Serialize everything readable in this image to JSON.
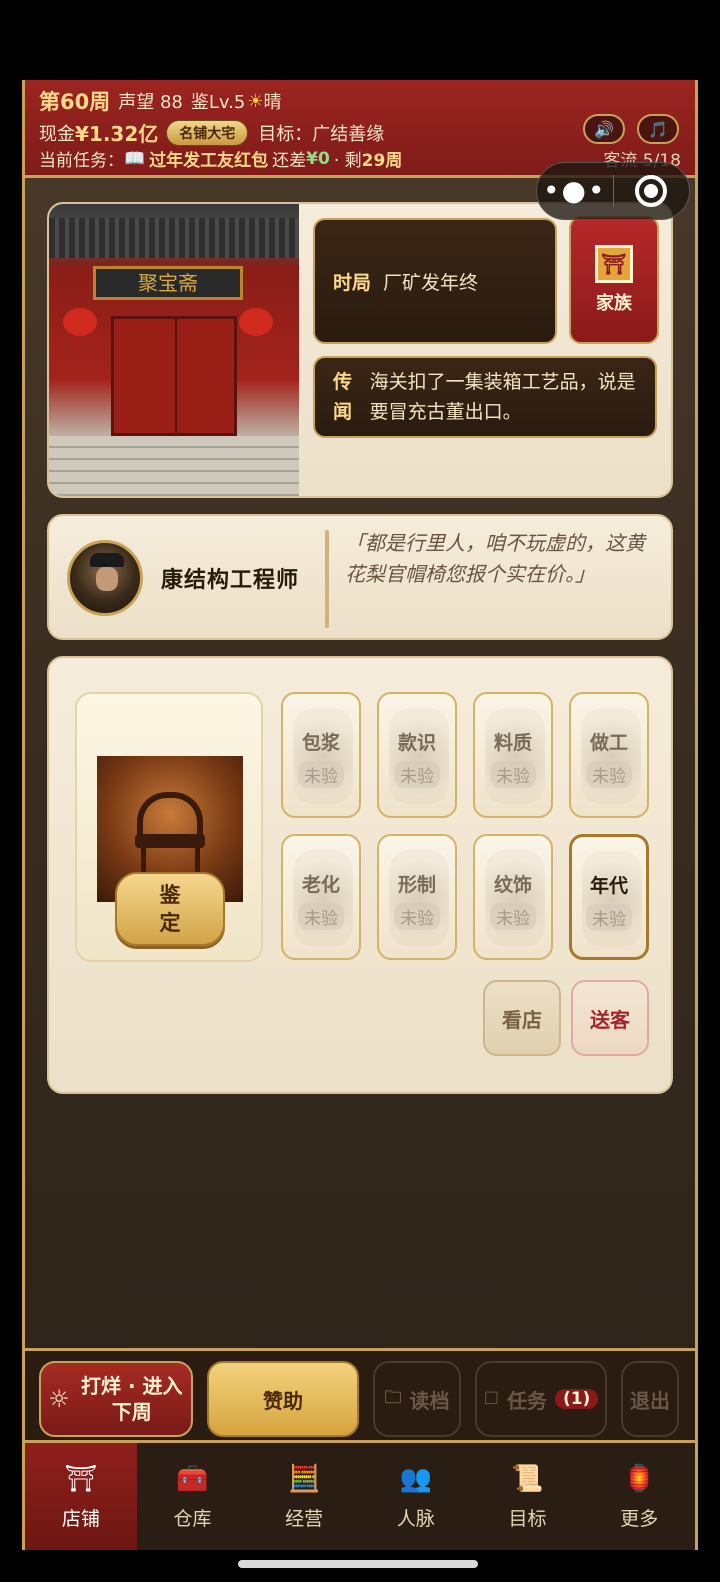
{
  "header": {
    "week": "第60周",
    "reputation": "声望 88",
    "level": "鉴Lv.5",
    "weather_icon": "☀",
    "weather": "晴",
    "cash_label": "现金",
    "cash_value": "¥1.32亿",
    "shop_rank": "名铺大宅",
    "goal": "目标：广结善缘",
    "task_label": "当前任务：",
    "task_icon": "📖",
    "task_name": "过年发工友红包",
    "task_remaining_label": "还差",
    "task_remaining_value": "¥0",
    "task_weeks": "· 剩",
    "task_weeks_value": "29周",
    "customer_flow": "客流 5/18",
    "sound_icon": "🔊",
    "music_icon": "🎵"
  },
  "capsule": {
    "more": "•●•"
  },
  "shop": {
    "plaque": "聚宝斋",
    "situation_label": "时局",
    "situation_text": "厂矿发年终",
    "rumor_label": "传闻",
    "rumor_text": "海关扣了一集装箱工艺品，说是要冒充古董出口。",
    "family_label": "家族"
  },
  "customer": {
    "name": "康结构工程师",
    "quote": "「都是行里人，咱不玩虚的，这黄花梨官帽椅您报个实在价。」"
  },
  "appraisal": {
    "appraise_btn": "鉴定",
    "attributes": [
      {
        "name": "包浆",
        "state": "未验"
      },
      {
        "name": "款识",
        "state": "未验"
      },
      {
        "name": "料质",
        "state": "未验"
      },
      {
        "name": "做工",
        "state": "未验"
      },
      {
        "name": "老化",
        "state": "未验"
      },
      {
        "name": "形制",
        "state": "未验"
      },
      {
        "name": "纹饰",
        "state": "未验"
      },
      {
        "name": "年代",
        "state": "未验"
      }
    ],
    "look_btn": "看店",
    "send_btn": "送客"
  },
  "actions": {
    "next_week": "打烊 · 进入下周",
    "sponsor": "赞助",
    "load": "读档",
    "task": "任务",
    "task_count": "(1)",
    "quit": "退出"
  },
  "tabs": [
    "店铺",
    "仓库",
    "经营",
    "人脉",
    "目标",
    "更多"
  ]
}
